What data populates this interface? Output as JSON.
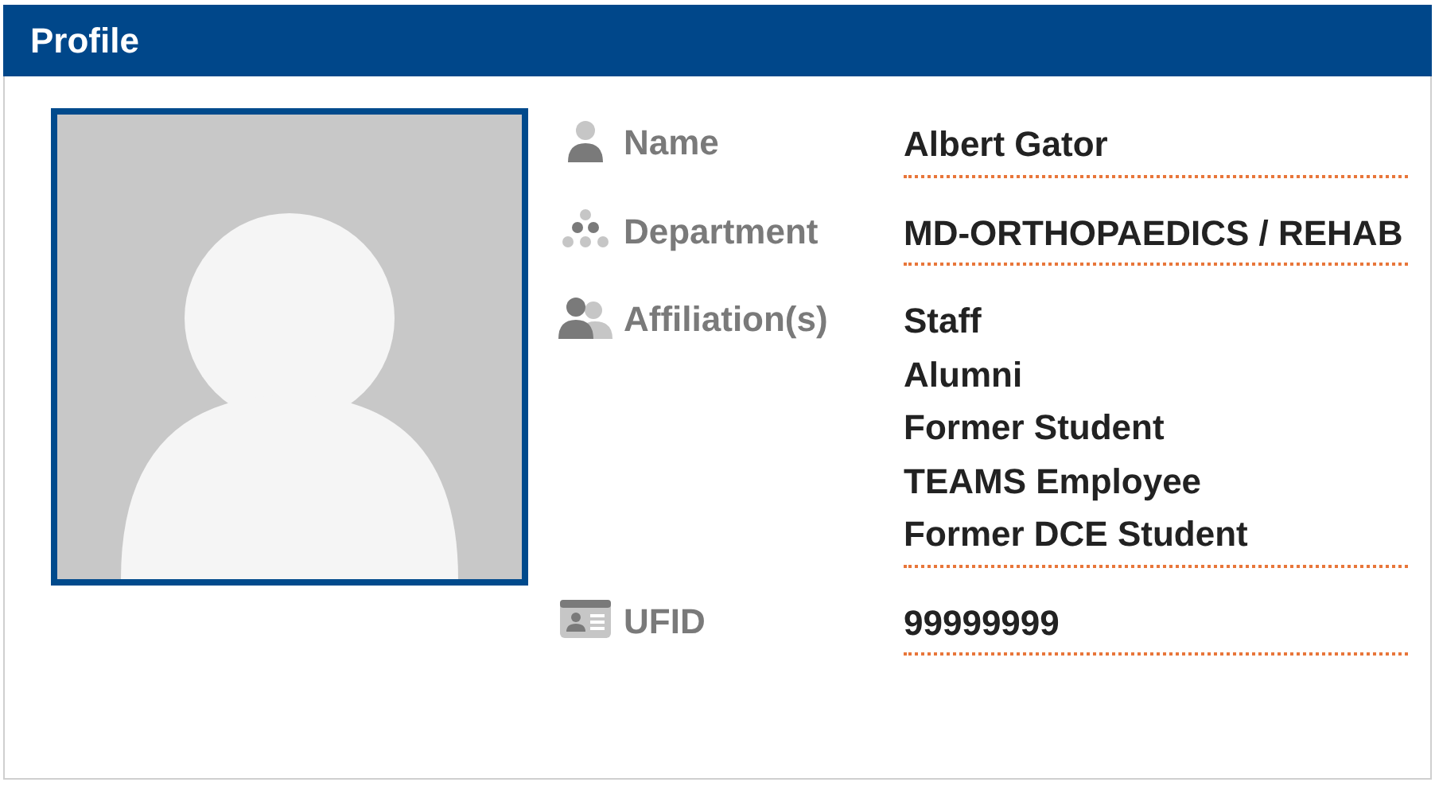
{
  "header": {
    "title": "Profile"
  },
  "photo": {
    "kind": "avatar"
  },
  "fields": [
    {
      "kind": "person",
      "label": "Name",
      "values": [
        "Albert Gator"
      ]
    },
    {
      "kind": "org",
      "label": "Department",
      "values": [
        "MD-ORTHOPAEDICS / REHAB"
      ]
    },
    {
      "kind": "people",
      "label": "Affiliation(s)",
      "values": [
        "Staff",
        "Alumni",
        "Former Student",
        "TEAMS Employee",
        "Former DCE Student"
      ]
    },
    {
      "kind": "idcard",
      "label": "UFID",
      "values": [
        "99999999"
      ]
    }
  ]
}
